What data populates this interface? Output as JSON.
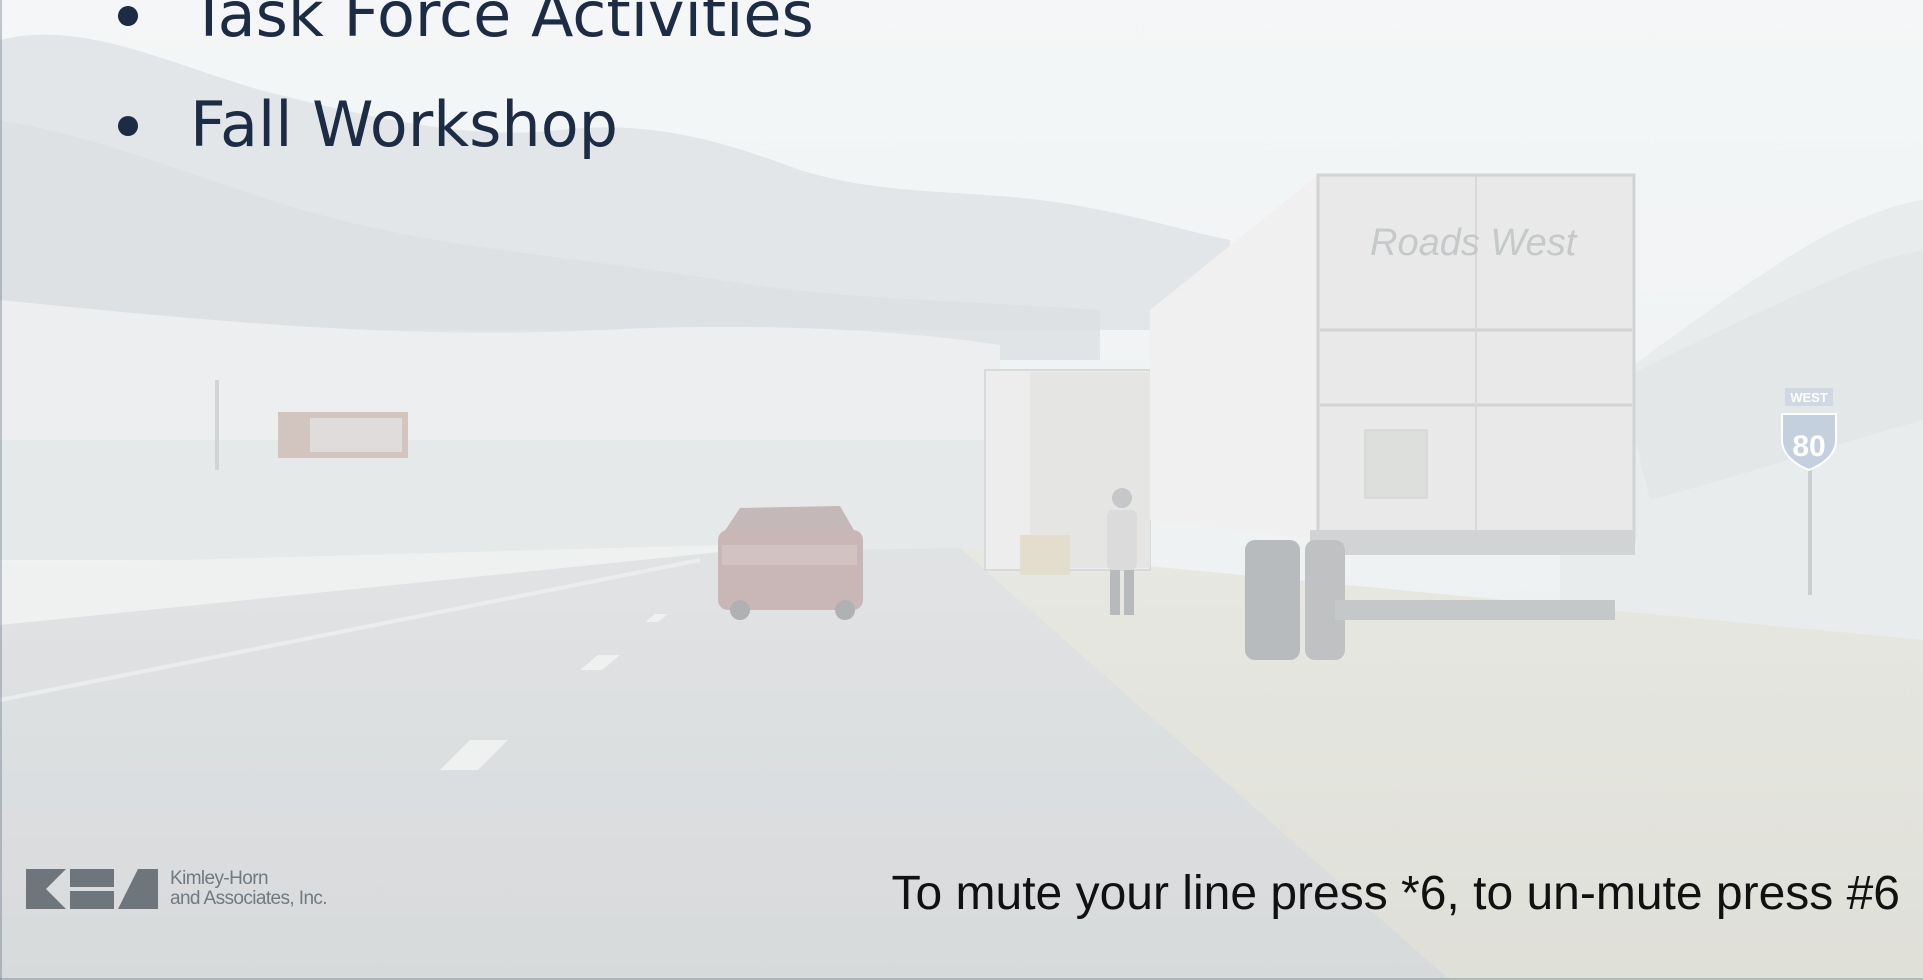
{
  "slide": {
    "bullets": [
      {
        "text": "Task Force Activities"
      },
      {
        "text": "Fall Workshop"
      }
    ],
    "background_photo": {
      "truck_brand_text": "Roads West",
      "shield_banner_text": "WEST",
      "route_number_text": "80",
      "billboard_text": ""
    },
    "footer": {
      "logo_name": "kimley-horn-logo",
      "company_line1": "Kimley-Horn",
      "company_line2": "and Associates, Inc.",
      "mute_instructions": "To mute your line press *6, to un-mute press #6"
    }
  },
  "colors": {
    "title_text": "#1c2c45",
    "logo_gray": "#6f767b",
    "sky": "#eef1f2",
    "road": "#cfd2d3"
  }
}
